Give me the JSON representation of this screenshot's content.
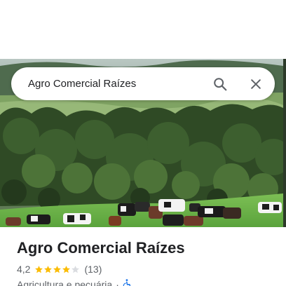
{
  "search": {
    "query": "Agro Comercial Raízes",
    "search_icon": "search-icon",
    "close_icon": "close-icon"
  },
  "hero_image": {
    "description_icon": "farm-photo"
  },
  "place": {
    "name": "Agro Comercial Raízes",
    "rating": "4,2",
    "stars_filled": 4,
    "stars_total": 5,
    "review_count": "(13)",
    "category": "Agricultura e pecuária",
    "separator": "·",
    "accessibility_icon": "wheelchair-icon"
  },
  "colors": {
    "star_filled": "#fbbc04",
    "star_empty": "#dadce0",
    "accessibility": "#1a73e8"
  }
}
